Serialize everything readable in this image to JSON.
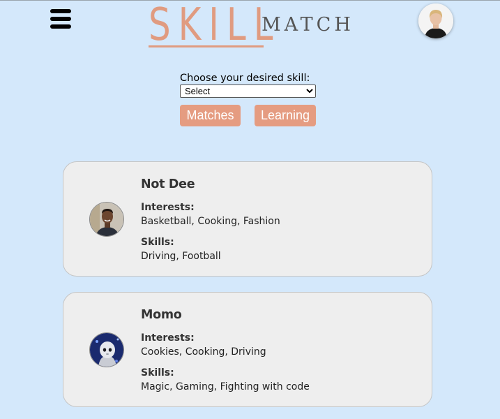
{
  "header": {
    "logo_primary": "SKILL",
    "logo_secondary": "MATCH"
  },
  "controls": {
    "choose_label": "Choose your desired skill:",
    "select_value": "Select",
    "matches_label": "Matches",
    "learning_label": "Learning"
  },
  "matches": [
    {
      "name": "Not Dee",
      "interests_label": "Interests:",
      "interests": "Basketball, Cooking, Fashion",
      "skills_label": "Skills:",
      "skills": "Driving, Football"
    },
    {
      "name": "Momo",
      "interests_label": "Interests:",
      "interests": "Cookies, Cooking, Driving",
      "skills_label": "Skills:",
      "skills": "Magic, Gaming, Fighting with code"
    }
  ],
  "colors": {
    "background": "#d4e8fb",
    "accent": "#e59c81",
    "card": "#eeeeee"
  }
}
